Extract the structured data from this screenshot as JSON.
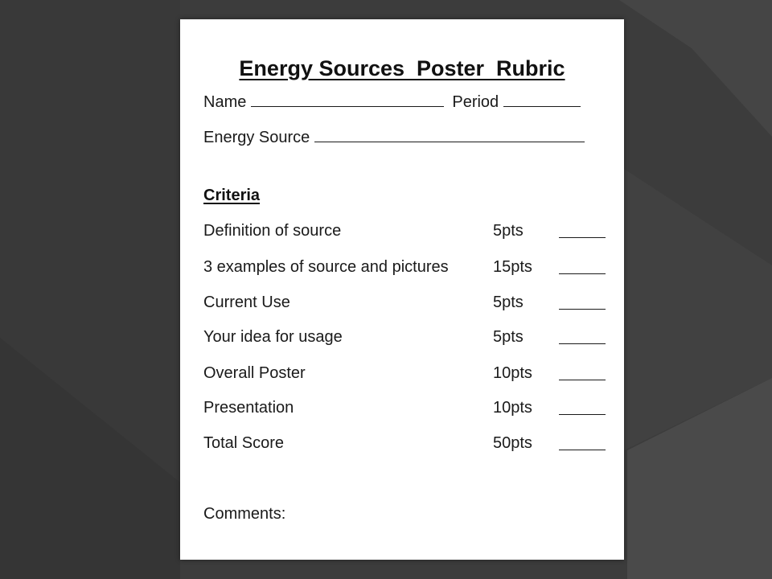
{
  "document": {
    "title": "Energy Sources  Poster  Rubric",
    "fields": {
      "name_label": "Name",
      "period_label": "Period",
      "energy_source_label": "Energy Source"
    },
    "criteria_heading": "Criteria",
    "criteria": [
      {
        "label": "Definition of source",
        "points": "5pts"
      },
      {
        "label": "3 examples of source and pictures",
        "points": "15pts"
      },
      {
        "label": "Current Use",
        "points": "5pts"
      },
      {
        "label": "Your idea for usage",
        "points": "5pts"
      },
      {
        "label": "Overall Poster",
        "points": "10pts"
      },
      {
        "label": "Presentation",
        "points": "10pts"
      },
      {
        "label": "Total Score",
        "points": "50pts"
      }
    ],
    "comments_label": "Comments:"
  },
  "colors": {
    "background": "#3c3c3c",
    "page": "#ffffff",
    "text": "#1a1a1a"
  }
}
